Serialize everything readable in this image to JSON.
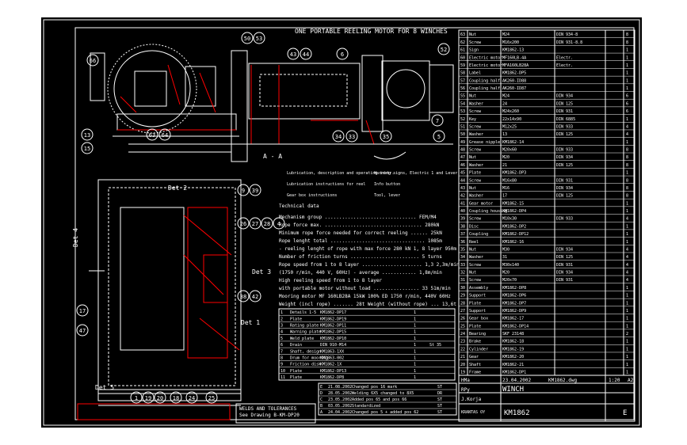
{
  "balloons": [
    "50",
    "53",
    "43",
    "44",
    "6",
    "52",
    "66",
    "7",
    "5",
    "13",
    "15",
    "63",
    "64",
    "34",
    "33",
    "35",
    "9",
    "39",
    "26",
    "27",
    "28",
    "4",
    "38",
    "42",
    "17",
    "47",
    "1",
    "19",
    "20",
    "18",
    "24",
    "25"
  ],
  "views": {
    "top_title": "ONE PORTABLE REELING MOTOR FOR 8 WINCHES",
    "section": "A - A",
    "det2": "Det 2",
    "det4": "Det 4",
    "det3": "Det 3",
    "det1": "Det 1",
    "det5": "Det 5"
  },
  "notes": [
    "Lubrication, description and operating instr.",
    "Lubrication instructions for reel",
    "Gear box instructions",
    "Warning signs, Electric 1 and Lever",
    "Info button",
    "Tool, lever"
  ],
  "tech": {
    "title": "Technical data",
    "lines": [
      "Mechanism group ................................ FEM/M4",
      "Rope force max. .................................. 280kN",
      "Minimum rope force needed for correct reeling ...... 25kN",
      "Rope lenght total ................................. 1085m",
      "- reeling lenght of rope with max force 280 kN  1, 8 layer  950m",
      "Number of friction turns ........................ 5 turns",
      "Rope speed from 1 to 8 layer ..................... 1,3 2,3m/min",
      "(1750 r/min, 440 V, 60Hz) - average ............ 1,8m/min",
      "High reeling speed from 1 to 8 layer",
      "with portable motor without load ................ 33 51m/min",
      "Mooring motor MF 160LB28A  15kW 100% ED 1750 r/min, 440V 60Hz",
      "Weight (incl rope) ....... 28t     Weight (without rope) ... 13,6t"
    ]
  },
  "bom_lower": [
    [
      "1",
      "Details 1-5",
      "KM1862-DP17",
      "1",
      ""
    ],
    [
      "2",
      "Plate",
      "KM1862-DP19",
      "1",
      ""
    ],
    [
      "3",
      "Rating plate",
      "KM1862-DP11",
      "1",
      ""
    ],
    [
      "4",
      "Warning plate",
      "KM1862-DP15",
      "1",
      ""
    ],
    [
      "5",
      "Weld plate",
      "KM1862-DP10",
      "1",
      ""
    ],
    [
      "6",
      "Drain",
      "DIN 910-M14",
      "1",
      "St 35"
    ],
    [
      "7",
      "Shaft, design",
      "KM1863-1XX",
      "1",
      ""
    ],
    [
      "8",
      "Drum for mooring",
      "KM1863-002",
      "1",
      ""
    ],
    [
      "9",
      "Friction disk",
      "KM1862-1X",
      "1",
      ""
    ],
    [
      "10",
      "Plate",
      "KM1862-DP13",
      "1",
      ""
    ],
    [
      "11",
      "Plate",
      "KM1862-DP8",
      "1",
      ""
    ]
  ],
  "revisions": [
    [
      "E",
      "21.08.2002",
      "Changed pos 16 mark",
      "ST"
    ],
    [
      "D",
      "28.05.2002",
      "Welding 6X5 changed to 8X5",
      "DR"
    ],
    [
      "C",
      "23.05.2002",
      "Added pos 65 and pos 66",
      "ST"
    ],
    [
      "B",
      "03.05.2002",
      "Standardized",
      "ST"
    ],
    [
      "A",
      "24.04.2002",
      "Changed pos 5 + added pos 62",
      "ST"
    ]
  ],
  "bom_right": [
    [
      "63",
      "Nut",
      "M24",
      "DIN 934-8",
      "8"
    ],
    [
      "62",
      "Screw",
      "M16x200",
      "DIN 931-8.8",
      "8"
    ],
    [
      "61",
      "Sign",
      "KM1862-13",
      "",
      "1"
    ],
    [
      "60",
      "Electric motor",
      "MF160LB-4A",
      "Electr.",
      "1"
    ],
    [
      "59",
      "Electric motor",
      "MFA160LB28A",
      "Electr.",
      "1"
    ],
    [
      "58",
      "Label",
      "KM1862-DP5",
      "",
      "1"
    ],
    [
      "57",
      "Coupling half",
      "AK260-ID88",
      "",
      "1"
    ],
    [
      "56",
      "Coupling half",
      "AK260-ID87",
      "",
      "1"
    ],
    [
      "55",
      "Nut",
      "M24",
      "DIN 934",
      "6"
    ],
    [
      "54",
      "Washer",
      "24",
      "DIN 125",
      "6"
    ],
    [
      "53",
      "Screw",
      "M24x260",
      "DIN 931",
      "6"
    ],
    [
      "52",
      "Key",
      "22x14x90",
      "DIN 6885",
      "1"
    ],
    [
      "51",
      "Screw",
      "M12x25",
      "DIN 933",
      "4"
    ],
    [
      "50",
      "Washer",
      "13",
      "DIN 125",
      "4"
    ],
    [
      "49",
      "Grease nipple",
      "KM1862-14",
      "",
      "1"
    ],
    [
      "48",
      "Screw",
      "M20x60",
      "DIN 933",
      "8"
    ],
    [
      "47",
      "Nut",
      "M20",
      "DIN 934",
      "8"
    ],
    [
      "46",
      "Washer",
      "21",
      "DIN 125",
      "8"
    ],
    [
      "45",
      "Plate",
      "KM1862-DP3",
      "",
      "1"
    ],
    [
      "44",
      "Screw",
      "M16x80",
      "DIN 931",
      "8"
    ],
    [
      "43",
      "Nut",
      "M16",
      "DIN 934",
      "8"
    ],
    [
      "42",
      "Washer",
      "17",
      "DIN 125",
      "8"
    ],
    [
      "41",
      "Gear motor",
      "KM1862-15",
      "",
      "1"
    ],
    [
      "40",
      "Coupling housing",
      "KM1862-DP4",
      "",
      "1"
    ],
    [
      "39",
      "Screw",
      "M10x30",
      "DIN 933",
      "4"
    ],
    [
      "38",
      "Disc",
      "KM1862-DP2",
      "",
      "1"
    ],
    [
      "37",
      "Coupling",
      "KM1862-DP12",
      "",
      "1"
    ],
    [
      "36",
      "Reel",
      "KM1862-16",
      "",
      "1"
    ],
    [
      "35",
      "Nut",
      "M30",
      "DIN 934",
      "4"
    ],
    [
      "34",
      "Washer",
      "31",
      "DIN 125",
      "4"
    ],
    [
      "33",
      "Screw",
      "M30x140",
      "DIN 931",
      "4"
    ],
    [
      "32",
      "Nut",
      "M20",
      "DIN 934",
      "4"
    ],
    [
      "31",
      "Screw",
      "M20x70",
      "DIN 931",
      "4"
    ],
    [
      "30",
      "Assembly",
      "KM1862-DP8",
      "",
      "1"
    ],
    [
      "29",
      "Support",
      "KM1862-DP6",
      "",
      "1"
    ],
    [
      "28",
      "Plate",
      "KM1862-DP7",
      "",
      "1"
    ],
    [
      "27",
      "Support",
      "KM1862-DP9",
      "",
      "1"
    ],
    [
      "26",
      "Gear box",
      "KM1862-17",
      "",
      "1"
    ],
    [
      "25",
      "Plate",
      "KM1862-DP14",
      "",
      "1"
    ],
    [
      "24",
      "Bearing",
      "SKF 23148",
      "",
      "2"
    ],
    [
      "23",
      "Brake",
      "KM1862-18",
      "",
      "1"
    ],
    [
      "22",
      "Cylinder",
      "KM1862-19",
      "",
      "1"
    ],
    [
      "21",
      "Gear",
      "KM1862-20",
      "",
      "1"
    ],
    [
      "20",
      "Shaft",
      "KM1862-21",
      "",
      "1"
    ],
    [
      "19",
      "Frame",
      "KM1862-DP1",
      "",
      "1"
    ]
  ],
  "welds": {
    "title": "WELDS AND TOLERANCES",
    "line": "See Drawing  B-KM-DP20"
  },
  "title_block": {
    "designer": "HMa",
    "date": "23.04.2002",
    "file": "KM1862.dwg",
    "scale": "1:20",
    "size": "A2",
    "drawn": "RPy",
    "title": "WINCH",
    "checked": "J.Korja",
    "company": "KRANTAS OY",
    "drawing_no": "KM1862",
    "revision": "E"
  }
}
